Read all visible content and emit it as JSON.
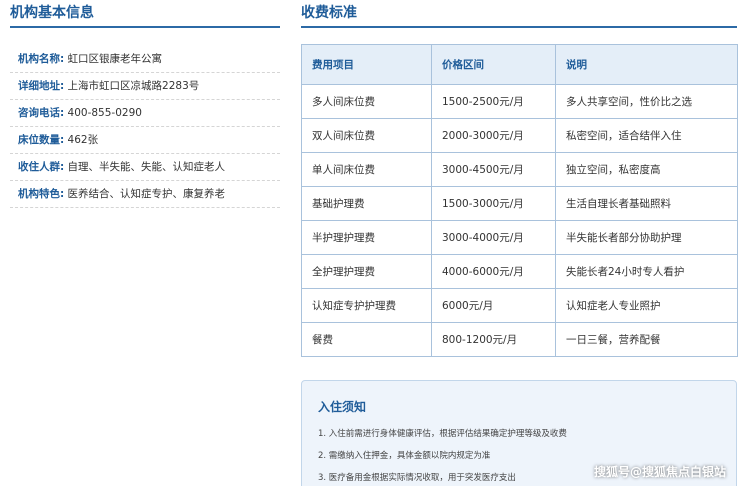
{
  "institution": {
    "title": "机构基本信息",
    "rows": [
      {
        "label": "机构名称:",
        "value": "虹口区银康老年公寓"
      },
      {
        "label": "详细地址:",
        "value": "上海市虹口区凉城路2283号"
      },
      {
        "label": "咨询电话:",
        "value": "400-855-0290"
      },
      {
        "label": "床位数量:",
        "value": "462张"
      },
      {
        "label": "收住人群:",
        "value": "自理、半失能、失能、认知症老人"
      },
      {
        "label": "机构特色:",
        "value": "医养结合、认知症专护、康复养老"
      }
    ]
  },
  "fees": {
    "title": "收费标准",
    "headers": [
      "费用项目",
      "价格区间",
      "说明"
    ],
    "rows": [
      [
        "多人间床位费",
        "1500-2500元/月",
        "多人共享空间，性价比之选"
      ],
      [
        "双人间床位费",
        "2000-3000元/月",
        "私密空间，适合结伴入住"
      ],
      [
        "单人间床位费",
        "3000-4500元/月",
        "独立空间，私密度高"
      ],
      [
        "基础护理费",
        "1500-3000元/月",
        "生活自理长者基础照料"
      ],
      [
        "半护理护理费",
        "3000-4000元/月",
        "半失能长者部分协助护理"
      ],
      [
        "全护理护理费",
        "4000-6000元/月",
        "失能长者24小时专人看护"
      ],
      [
        "认知症专护护理费",
        "6000元/月",
        "认知症老人专业照护"
      ],
      [
        "餐费",
        "800-1200元/月",
        "一日三餐，营养配餐"
      ]
    ]
  },
  "notice": {
    "title": "入住须知",
    "items": [
      "1. 入住前需进行身体健康评估，根据评估结果确定护理等级及收费",
      "2. 需缴纳入住押金，具体金额以院内规定为准",
      "3. 医疗备用金根据实际情况收取，用于突发医疗支出"
    ]
  },
  "watermark": "搜狐号@搜狐焦点白银站",
  "colors": {
    "accent": "#1f5c99",
    "header_bg": "#e4eef8",
    "notice_bg": "#eef4fb"
  }
}
